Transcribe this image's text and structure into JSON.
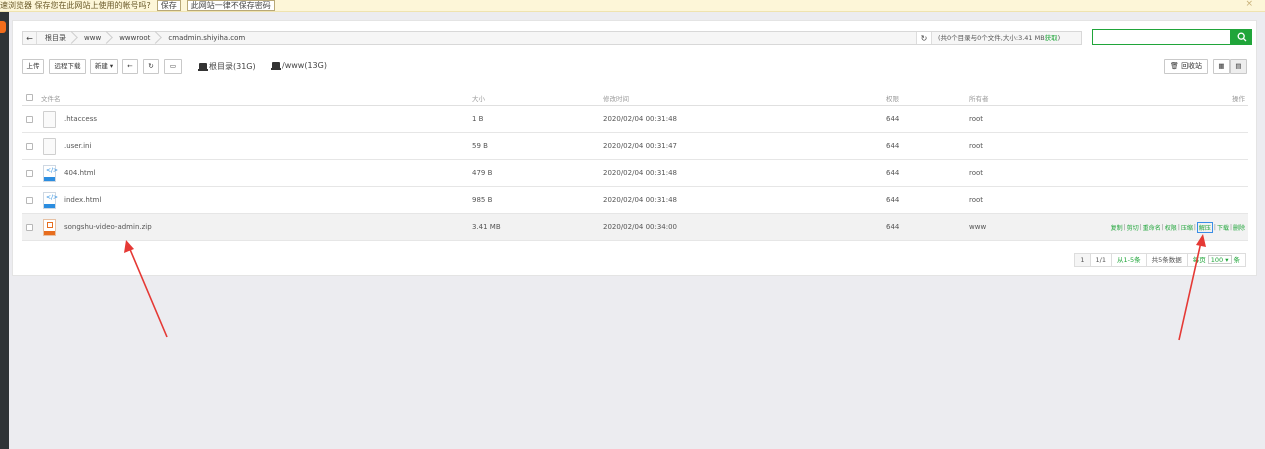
{
  "notice": {
    "text": "速浏览器 保存您在此网站上使用的帐号吗?",
    "save_label": "保存",
    "never_label": "此网站一律不保存密码",
    "close_glyph": "×"
  },
  "breadcrumb": {
    "back_glyph": "←",
    "items": [
      "根目录",
      "www",
      "wwwroot",
      "cmadmin.shiyiha.com"
    ],
    "refresh_glyph": "↻",
    "summary_prefix": "(共0个目录与0个文件,大小:3.41 MB",
    "summary_link": "获取",
    "summary_suffix": ")"
  },
  "search": {
    "placeholder": "",
    "icon": "search-icon"
  },
  "toolbar": {
    "upload_label": "上传",
    "remote_download_label": "远程下载",
    "new_label": "新建 ▾",
    "back_glyph": "←",
    "refresh_glyph": "↻",
    "terminal_glyph": "▭",
    "disk_root": "根目录(31G)",
    "disk_www": "/www(13G)",
    "recycle_label": "回收站",
    "view_grid_glyph": "▦",
    "view_list_glyph": "▤"
  },
  "table": {
    "headers": {
      "name": "文件名",
      "size": "大小",
      "mtime": "修改时间",
      "perm": "权限",
      "owner": "所有者",
      "ops": "操作"
    },
    "rows": [
      {
        "name": ".htaccess",
        "size": "1 B",
        "mtime": "2020/02/04 00:31:48",
        "perm": "644",
        "owner": "root",
        "icon": "file-icon"
      },
      {
        "name": ".user.ini",
        "size": "59 B",
        "mtime": "2020/02/04 00:31:47",
        "perm": "644",
        "owner": "root",
        "icon": "file-icon"
      },
      {
        "name": "404.html",
        "size": "479 B",
        "mtime": "2020/02/04 00:31:48",
        "perm": "644",
        "owner": "root",
        "icon": "html-file-icon"
      },
      {
        "name": "index.html",
        "size": "985 B",
        "mtime": "2020/02/04 00:31:48",
        "perm": "644",
        "owner": "root",
        "icon": "html-file-icon"
      },
      {
        "name": "songshu-video-admin.zip",
        "size": "3.41 MB",
        "mtime": "2020/02/04 00:34:00",
        "perm": "644",
        "owner": "www",
        "icon": "zip-file-icon"
      }
    ],
    "row_actions": {
      "copy": "复制",
      "cut": "剪切",
      "rename": "重命名",
      "perm": "权限",
      "compress": "压缩",
      "extract": "解压",
      "download": "下载",
      "delete": "删除"
    }
  },
  "pager": {
    "page": "1",
    "pages": "1/1",
    "range": "从1-5条",
    "total": "共5条数据",
    "per_page_prefix": "每页",
    "per_page_value": "100",
    "per_page_suffix": "条"
  },
  "colors": {
    "accent": "#20a53a",
    "annotation": "#e53935",
    "highlight_box": "#3a8ee6"
  }
}
